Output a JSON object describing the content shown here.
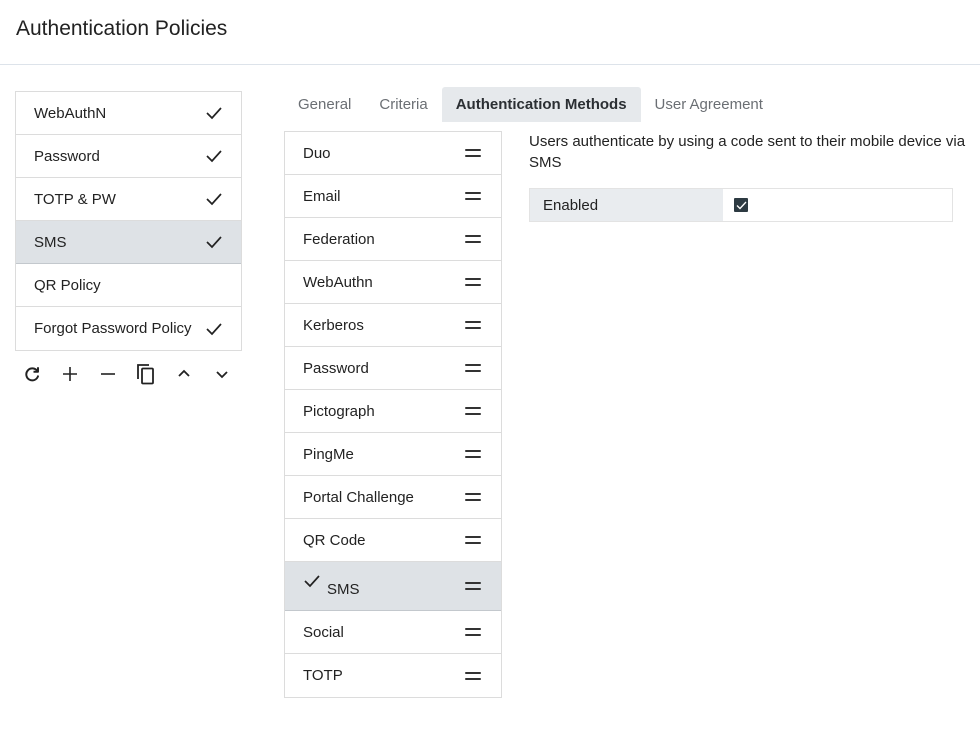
{
  "header": {
    "title": "Authentication Policies"
  },
  "policies": [
    {
      "label": "WebAuthN",
      "checked": true,
      "selected": false
    },
    {
      "label": "Password",
      "checked": true,
      "selected": false
    },
    {
      "label": "TOTP & PW",
      "checked": true,
      "selected": false
    },
    {
      "label": "SMS",
      "checked": true,
      "selected": true
    },
    {
      "label": "QR Policy",
      "checked": false,
      "selected": false
    },
    {
      "label": "Forgot Password Policy",
      "checked": true,
      "selected": false
    }
  ],
  "toolbar": {
    "buttons": [
      {
        "name": "refresh",
        "icon": "refresh-icon"
      },
      {
        "name": "add",
        "icon": "plus-icon"
      },
      {
        "name": "remove",
        "icon": "minus-icon"
      },
      {
        "name": "copy",
        "icon": "copy-icon"
      },
      {
        "name": "move-up",
        "icon": "chevron-up-icon"
      },
      {
        "name": "move-down",
        "icon": "chevron-down-icon"
      }
    ]
  },
  "tabs": [
    {
      "label": "General",
      "active": false
    },
    {
      "label": "Criteria",
      "active": false
    },
    {
      "label": "Authentication Methods",
      "active": true
    },
    {
      "label": "User Agreement",
      "active": false
    }
  ],
  "methods": [
    {
      "label": "Duo",
      "selected": false
    },
    {
      "label": "Email",
      "selected": false
    },
    {
      "label": "Federation",
      "selected": false
    },
    {
      "label": "WebAuthn",
      "selected": false
    },
    {
      "label": "Kerberos",
      "selected": false
    },
    {
      "label": "Password",
      "selected": false
    },
    {
      "label": "Pictograph",
      "selected": false
    },
    {
      "label": "PingMe",
      "selected": false
    },
    {
      "label": "Portal Challenge",
      "selected": false
    },
    {
      "label": "QR Code",
      "selected": false
    },
    {
      "label": "SMS",
      "selected": true
    },
    {
      "label": "Social",
      "selected": false
    },
    {
      "label": "TOTP",
      "selected": false
    }
  ],
  "detail": {
    "description": "Users authenticate by using a code sent to their mobile device via SMS",
    "properties": [
      {
        "label": "Enabled",
        "checked": true
      }
    ]
  }
}
